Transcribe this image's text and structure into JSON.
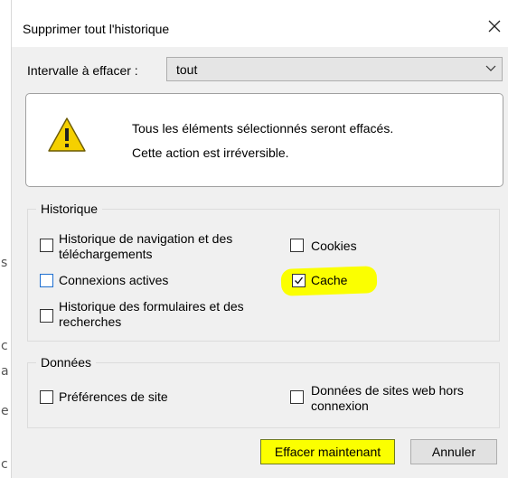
{
  "background": {
    "glyphs": [
      "s",
      "c",
      "a",
      "e",
      "c"
    ]
  },
  "dialog": {
    "title": "Supprimer tout l'historique",
    "close_icon": "close-icon"
  },
  "interval": {
    "label": "Intervalle à effacer :",
    "value": "tout"
  },
  "warning": {
    "icon": "warning-icon",
    "line1": "Tous les éléments sélectionnés seront effacés.",
    "line2": "Cette action est irréversible."
  },
  "historique": {
    "legend": "Historique",
    "items": [
      {
        "label_line1": "Historique de navigation et des",
        "label_line2": "téléchargements",
        "checked": false
      },
      {
        "label": "Cookies",
        "checked": false
      },
      {
        "label": "Connexions actives",
        "checked": false
      },
      {
        "label": "Cache",
        "checked": true
      },
      {
        "label_line1": "Historique des formulaires et des",
        "label_line2": "recherches",
        "checked": false
      }
    ]
  },
  "donnees": {
    "legend": "Données",
    "items": [
      {
        "label": "Préférences de site",
        "checked": false
      },
      {
        "label_line1": "Données de sites web hors",
        "label_line2": "connexion",
        "checked": false
      }
    ]
  },
  "buttons": {
    "primary": "Effacer maintenant",
    "cancel": "Annuler"
  },
  "colors": {
    "highlight": "#fbff00",
    "focus_border": "#1e6fd0",
    "dialog_bg": "#f0f0f0"
  }
}
